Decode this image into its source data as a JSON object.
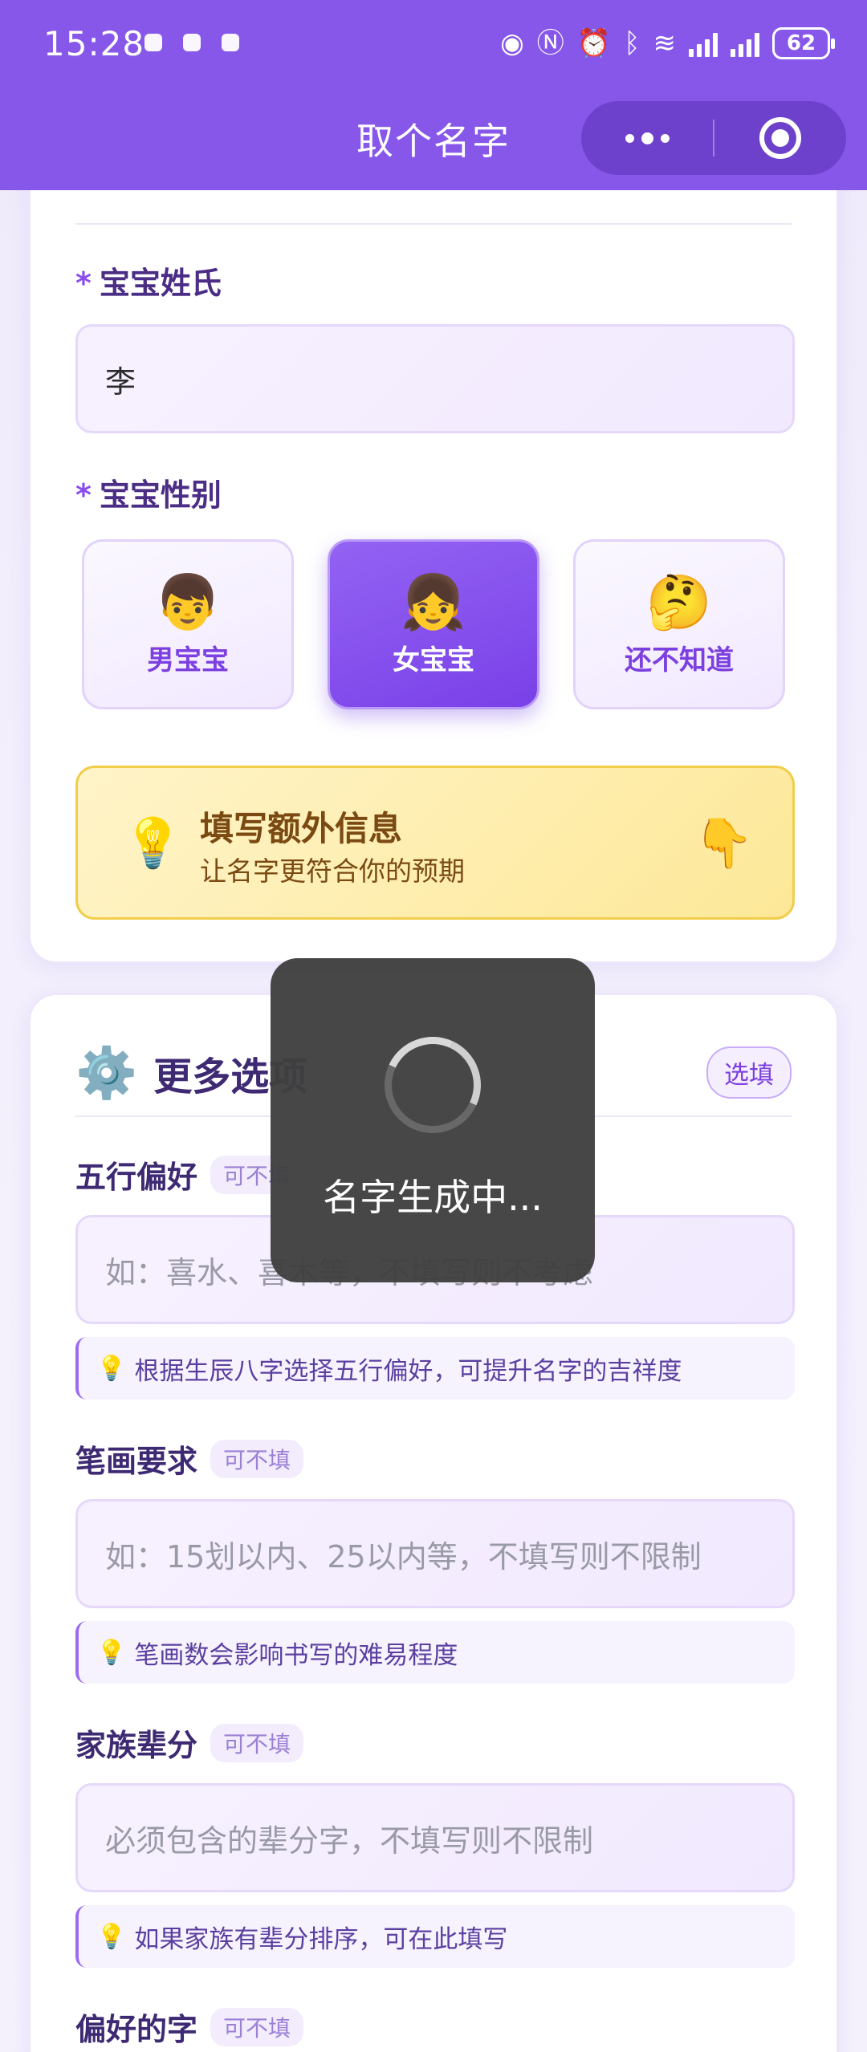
{
  "status_bar": {
    "time": "15:28",
    "battery": "62",
    "icons": [
      "eye-icon",
      "nfc-icon",
      "alarm-icon",
      "bluetooth-icon",
      "wifi-icon",
      "signal-icon",
      "4g-signal-icon"
    ]
  },
  "nav": {
    "title": "取个名字"
  },
  "basic_info": {
    "surname_label": "宝宝姓氏",
    "surname_value": "李",
    "gender_label": "宝宝性别",
    "gender_options": [
      {
        "emoji": "👦",
        "label": "男宝宝",
        "selected": false
      },
      {
        "emoji": "👧",
        "label": "女宝宝",
        "selected": true
      },
      {
        "emoji": "🤔",
        "label": "还不知道",
        "selected": false
      }
    ],
    "extra_title": "填写额外信息",
    "extra_subtitle": "让名字更符合你的预期",
    "required_mark": "*"
  },
  "more_options": {
    "title": "更多选项",
    "optional_badge": "选填",
    "optional_tag": "可不填",
    "wuxing_label": "五行偏好",
    "wuxing_placeholder": "如：喜水、喜木等，不填写则不考虑",
    "wuxing_tip": "根据生辰八字选择五行偏好，可提升名字的吉祥度",
    "strokes_label": "笔画要求",
    "strokes_placeholder": "如：15划以内、25以内等，不填写则不限制",
    "strokes_tip": "笔画数会影响书写的难易程度",
    "generation_label": "家族辈分",
    "generation_placeholder": "必须包含的辈分字，不填写则不限制",
    "generation_tip": "如果家族有辈分排序，可在此填写",
    "preferred_label": "偏好的字"
  },
  "toast": {
    "message": "名字生成中..."
  },
  "colors": {
    "brand_purple": "#8757ea",
    "selected_purple": "#7a40e8",
    "banner_yellow": "#fde898"
  }
}
